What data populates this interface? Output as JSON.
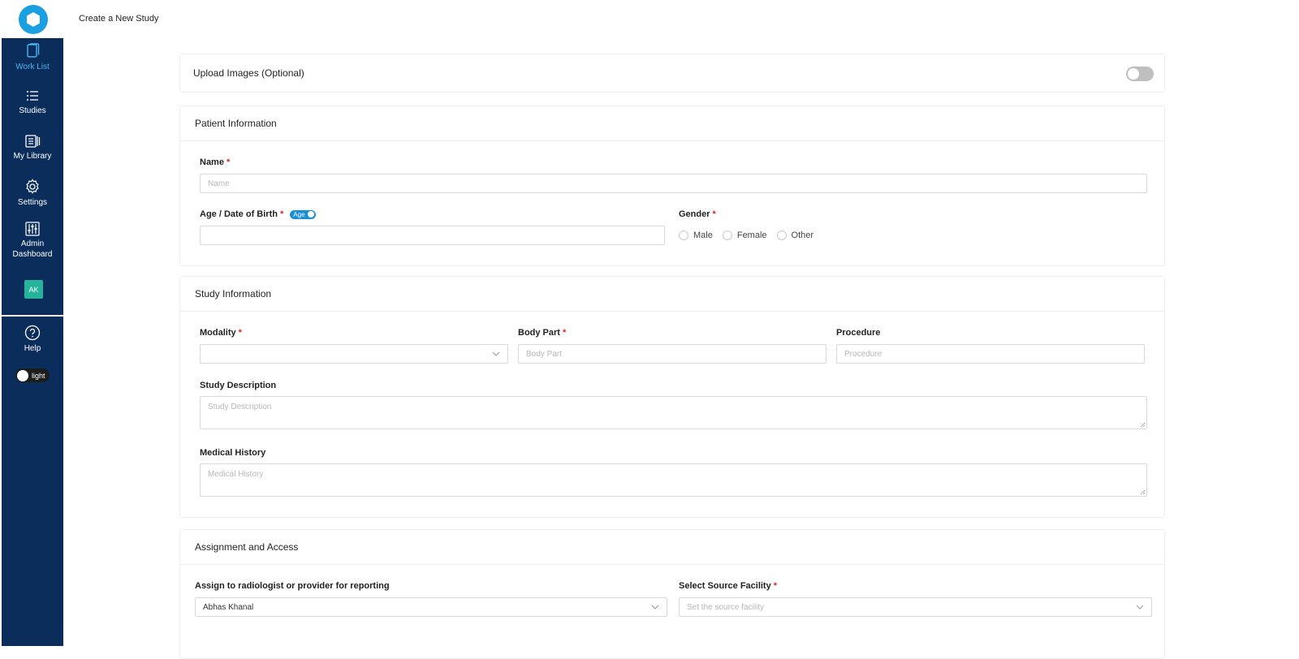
{
  "app": {
    "page_title": "Create a New Study"
  },
  "sidebar": {
    "items": [
      {
        "label": "Work List",
        "icon": "worklist-icon",
        "active": true
      },
      {
        "label": "Studies",
        "icon": "list-icon"
      },
      {
        "label": "My Library",
        "icon": "library-icon"
      },
      {
        "label": "Settings",
        "icon": "gear-icon"
      },
      {
        "label": "Admin Dashboard",
        "icon": "sliders-icon"
      }
    ],
    "avatar_initials": "AK",
    "help_label": "Help",
    "theme_label": "light"
  },
  "upload": {
    "label": "Upload Images (Optional)",
    "enabled": false
  },
  "patient": {
    "title": "Patient Information",
    "name_label": "Name",
    "name_placeholder": "Name",
    "age_label": "Age / Date of Birth",
    "age_toggle_label": "Age",
    "gender_label": "Gender",
    "gender_options": [
      "Male",
      "Female",
      "Other"
    ]
  },
  "study": {
    "title": "Study Information",
    "modality_label": "Modality",
    "body_part_label": "Body Part",
    "body_part_placeholder": "Body Part",
    "procedure_label": "Procedure",
    "procedure_placeholder": "Procedure",
    "description_label": "Study Description",
    "description_placeholder": "Study Description",
    "history_label": "Medical History",
    "history_placeholder": "Medical History"
  },
  "assignment": {
    "title": "Assignment and Access",
    "assign_label": "Assign to radiologist or provider for reporting",
    "assign_value": "Abhas Khanal",
    "facility_label": "Select Source Facility",
    "facility_placeholder": "Set the source facility"
  },
  "colors": {
    "sidebar": "#0b2d5b",
    "accent": "#1a9fe0",
    "required": "#e02424",
    "avatar": "#25b39b"
  }
}
